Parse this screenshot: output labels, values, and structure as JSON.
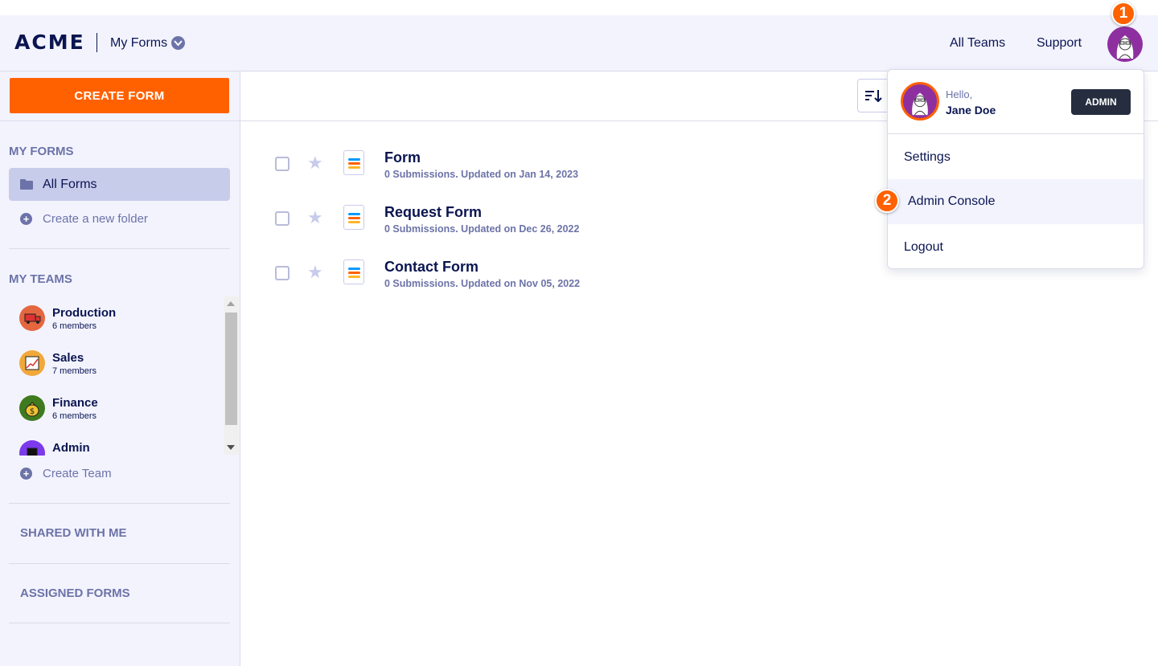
{
  "header": {
    "logo": "ACME",
    "title": "My Forms",
    "nav": [
      "All Teams",
      "Support"
    ]
  },
  "annotations": [
    "1",
    "2"
  ],
  "sidebar": {
    "create_label": "CREATE FORM",
    "my_forms_label": "MY FORMS",
    "all_forms_label": "All Forms",
    "new_folder_label": "Create a new folder",
    "my_teams_label": "MY TEAMS",
    "teams": [
      {
        "name": "Production",
        "members": "6 members",
        "color": "#e4673f"
      },
      {
        "name": "Sales",
        "members": "7 members",
        "color": "#f1a83a"
      },
      {
        "name": "Finance",
        "members": "6 members",
        "color": "#3f7a1f"
      },
      {
        "name": "Admin",
        "members": "",
        "color": "#7c3aed"
      }
    ],
    "create_team_label": "Create Team",
    "shared_label": "SHARED WITH ME",
    "assigned_label": "ASSIGNED FORMS"
  },
  "forms": [
    {
      "title": "Form",
      "meta": "0 Submissions. Updated on Jan 14, 2023"
    },
    {
      "title": "Request Form",
      "meta": "0 Submissions. Updated on Dec 26, 2022"
    },
    {
      "title": "Contact Form",
      "meta": "0 Submissions. Updated on Nov 05, 2022"
    }
  ],
  "user_menu": {
    "hello": "Hello,",
    "name": "Jane Doe",
    "role_badge": "ADMIN",
    "items": [
      "Settings",
      "Admin Console",
      "Logout"
    ]
  },
  "colors": {
    "accent": "#ff6100",
    "navy": "#0a1551",
    "sidebar_bg": "#f3f3fe",
    "avatar_bg": "#8e2fa0"
  }
}
